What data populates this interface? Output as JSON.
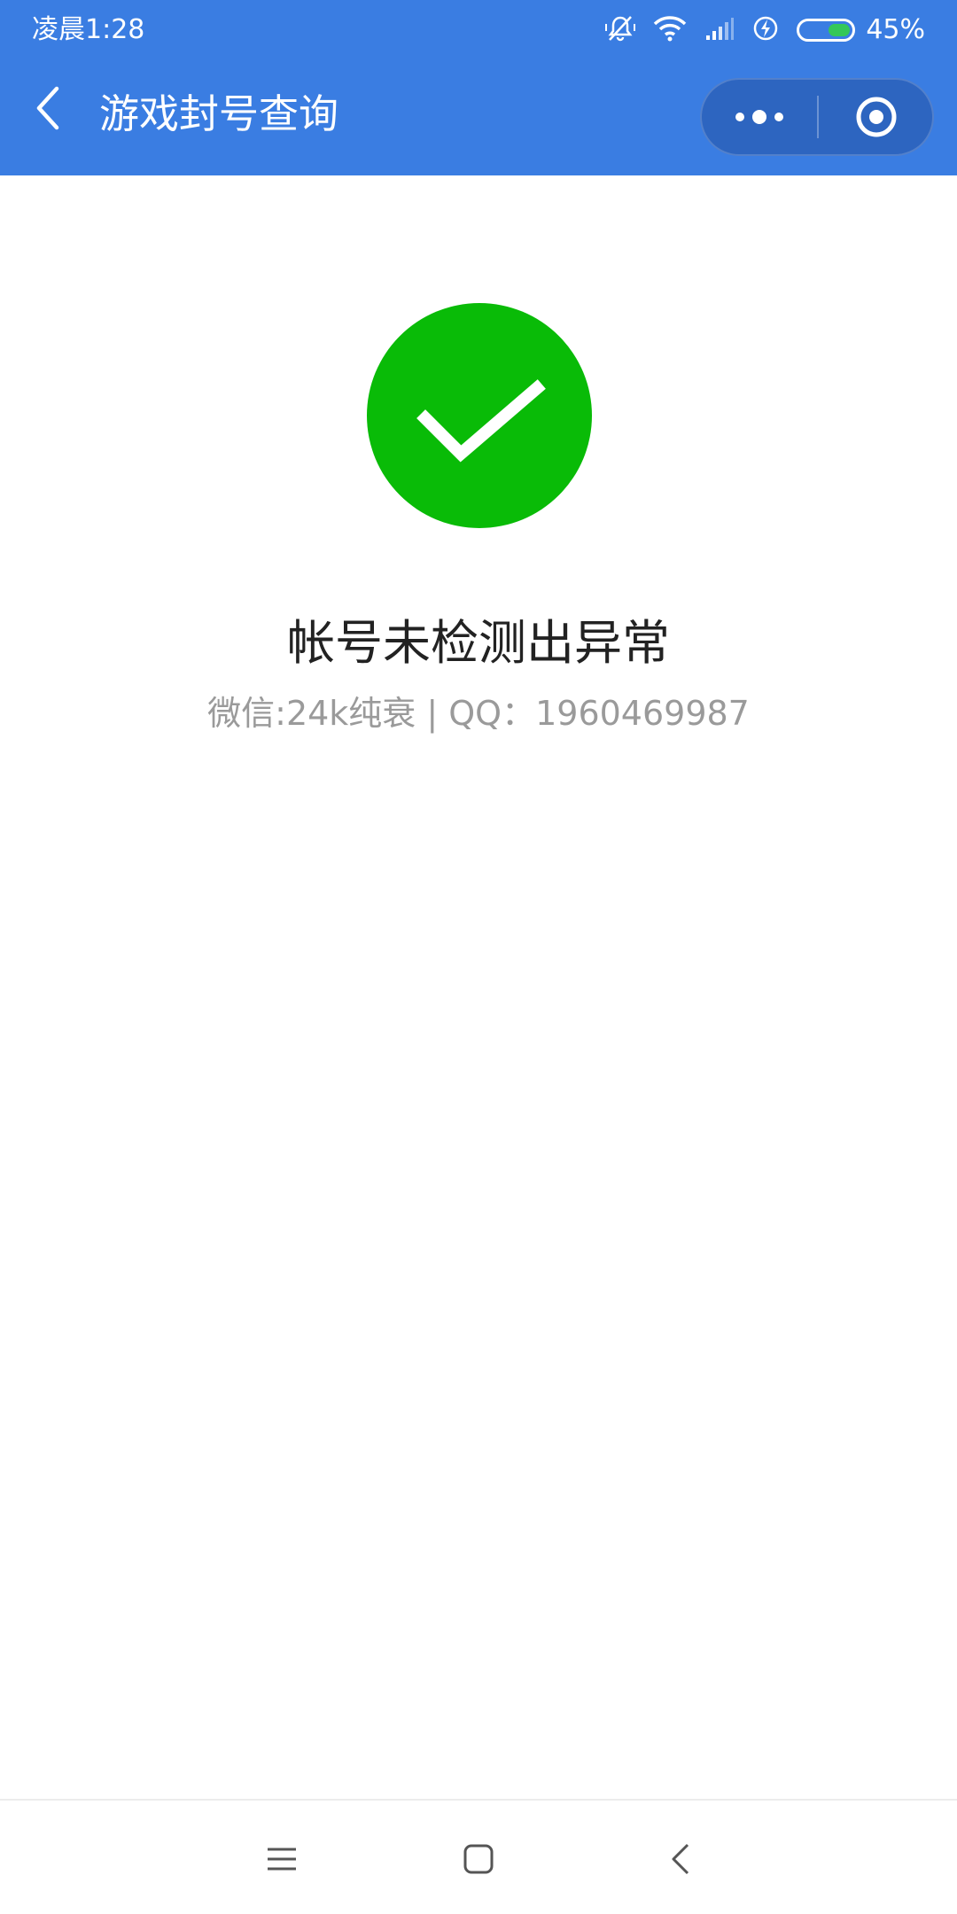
{
  "status_bar": {
    "time": "凌晨1:28",
    "battery_percent_text": "45%",
    "battery_level": 0.45,
    "icons": [
      "mute-vibrate-icon",
      "wifi-icon",
      "signal-icon",
      "charging-icon",
      "battery-icon"
    ]
  },
  "nav": {
    "title": "游戏封号查询",
    "back_icon": "chevron-left-icon",
    "more_icon": "more-dots-icon",
    "close_icon": "target-close-icon"
  },
  "result": {
    "icon": "check-circle-icon",
    "icon_color": "#09bb07",
    "title": "帐号未检测出异常",
    "subtitle": "微信:24k纯衰 | QQ：1960469987"
  },
  "bottom_nav": {
    "items": [
      "menu-icon",
      "home-square-icon",
      "back-chevron-icon"
    ]
  },
  "colors": {
    "header": "#3a7de2",
    "capsule": "#2d65c0",
    "success": "#09bb07"
  }
}
